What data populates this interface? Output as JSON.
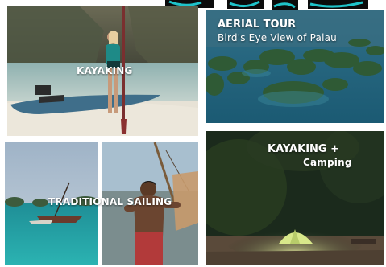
{
  "tiles": {
    "kayaking": {
      "label": "KAYAKING"
    },
    "aerial": {
      "title": "AERIAL TOUR",
      "subtitle": "Bird's Eye View of Palau"
    },
    "sailing": {
      "label": "TRADITIONAL SAILING"
    },
    "camping": {
      "title": "KAYAKING +",
      "subtitle": "Camping"
    }
  },
  "colors": {
    "header_black": "#0b0b0b",
    "header_teal": "#1fc3c9",
    "water_teal": "#3aa0a8",
    "deep_sea": "#1b4a60",
    "night_green": "#1b2a1c"
  }
}
